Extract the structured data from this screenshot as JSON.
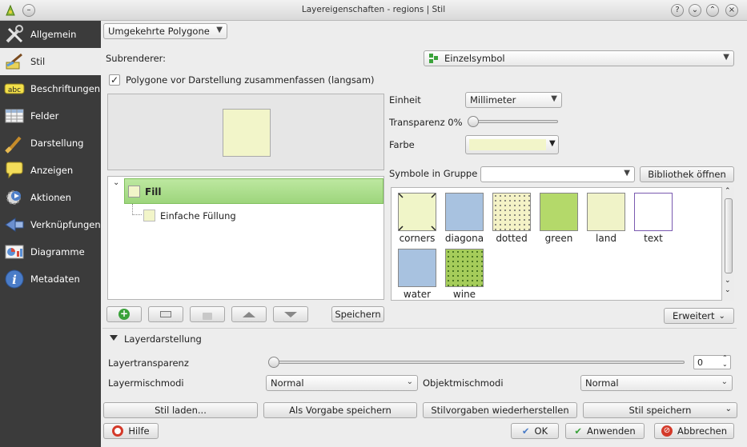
{
  "window": {
    "title": "Layereigenschaften - regions | Stil"
  },
  "sidebar": {
    "items": [
      {
        "label": "Allgemein",
        "icon": "tools-icon"
      },
      {
        "label": "Stil",
        "icon": "paint-brush-icon",
        "active": true
      },
      {
        "label": "Beschriftungen",
        "icon": "label-abc-icon"
      },
      {
        "label": "Felder",
        "icon": "table-icon"
      },
      {
        "label": "Darstellung",
        "icon": "brush-icon"
      },
      {
        "label": "Anzeigen",
        "icon": "speech-bubble-icon"
      },
      {
        "label": "Aktionen",
        "icon": "gear-play-icon"
      },
      {
        "label": "Verknüpfungen",
        "icon": "join-icon"
      },
      {
        "label": "Diagramme",
        "icon": "chart-icon"
      },
      {
        "label": "Metadaten",
        "icon": "info-icon"
      }
    ]
  },
  "renderer": {
    "type": "Umgekehrte Polygone",
    "subrenderer_label": "Subrenderer:",
    "subrenderer_value": "Einzelsymbol",
    "merge_label": "Polygone vor Darstellung zusammenfassen (langsam)",
    "merge_checked": true
  },
  "symbol_tree": {
    "root": "Fill",
    "child": "Einfache Füllung"
  },
  "props": {
    "unit_label": "Einheit",
    "unit_value": "Millimeter",
    "transparency_label": "Transparenz 0%",
    "transparency_value": 0,
    "color_label": "Farbe",
    "color_value": "#f2f5c9",
    "group_label": "Symbole in Gruppe",
    "group_value": "",
    "library_button": "Bibliothek öffnen"
  },
  "symbols": [
    {
      "name": "corners",
      "color": "#f0f5c8"
    },
    {
      "name": "diagona",
      "color": "#a8c2e0"
    },
    {
      "name": "dotted",
      "color": "#f4f2c6"
    },
    {
      "name": "green",
      "color": "#b4d96a"
    },
    {
      "name": "land",
      "color": "#f0f3c8"
    },
    {
      "name": "text",
      "color": "#ffffff"
    },
    {
      "name": "water",
      "color": "#a8c2e0"
    },
    {
      "name": "wine",
      "color": "#a5cc5a"
    }
  ],
  "toolbar": {
    "add_icon": "plus-icon",
    "remove_icon": "minus-icon",
    "lock_icon": "lock-icon",
    "up_icon": "up-arrow-icon",
    "down_icon": "down-arrow-icon",
    "save_label": "Speichern",
    "advanced_label": "Erweitert"
  },
  "layer_rendering": {
    "section_title": "Layerdarstellung",
    "transparency_label": "Layertransparenz",
    "transparency_value": "0",
    "layer_blend_label": "Layermischmodi",
    "layer_blend_value": "Normal",
    "feature_blend_label": "Objektmischmodi",
    "feature_blend_value": "Normal"
  },
  "style_buttons": {
    "load": "Stil laden...",
    "save_default": "Als Vorgabe speichern",
    "restore": "Stilvorgaben wiederherstellen",
    "save": "Stil speichern"
  },
  "footer": {
    "help": "Hilfe",
    "ok": "OK",
    "apply": "Anwenden",
    "cancel": "Abbrechen"
  },
  "colors": {
    "sidebar_bg": "#3b3b3b",
    "tree_selected": "#aede8f",
    "preview_fill": "#f2f5c9"
  }
}
